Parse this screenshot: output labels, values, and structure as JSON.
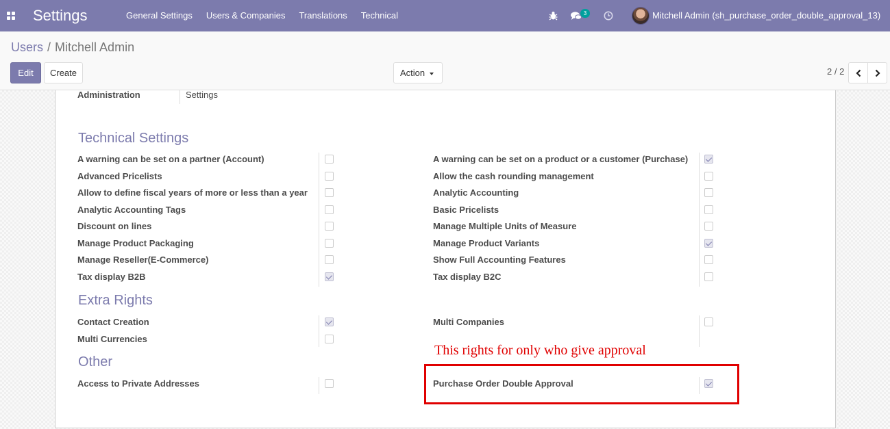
{
  "navbar": {
    "app_title": "Settings",
    "menu": [
      "General Settings",
      "Users & Companies",
      "Translations",
      "Technical"
    ],
    "chat_badge": "3",
    "user": "Mitchell Admin (sh_purchase_order_double_approval_13)"
  },
  "breadcrumb": {
    "parent": "Users",
    "sep": "/",
    "current": "Mitchell Admin"
  },
  "buttons": {
    "edit": "Edit",
    "create": "Create",
    "action": "Action"
  },
  "pager": {
    "value": "2 / 2"
  },
  "admin": {
    "label": "Administration",
    "value": "Settings"
  },
  "sections": {
    "technical": "Technical Settings",
    "extra": "Extra Rights",
    "other": "Other"
  },
  "technical_left": [
    {
      "label": "A warning can be set on a partner (Account)",
      "checked": false
    },
    {
      "label": "Advanced Pricelists",
      "checked": false
    },
    {
      "label": "Allow to define fiscal years of more or less than a year",
      "checked": false
    },
    {
      "label": "Analytic Accounting Tags",
      "checked": false
    },
    {
      "label": "Discount on lines",
      "checked": false
    },
    {
      "label": "Manage Product Packaging",
      "checked": false
    },
    {
      "label": "Manage Reseller(E-Commerce)",
      "checked": false
    },
    {
      "label": "Tax display B2B",
      "checked": true
    }
  ],
  "technical_right": [
    {
      "label": "A warning can be set on a product or a customer (Purchase)",
      "checked": true
    },
    {
      "label": "Allow the cash rounding management",
      "checked": false
    },
    {
      "label": "Analytic Accounting",
      "checked": false
    },
    {
      "label": "Basic Pricelists",
      "checked": false
    },
    {
      "label": "Manage Multiple Units of Measure",
      "checked": false
    },
    {
      "label": "Manage Product Variants",
      "checked": true
    },
    {
      "label": "Show Full Accounting Features",
      "checked": false
    },
    {
      "label": "Tax display B2C",
      "checked": false
    }
  ],
  "extra_left": [
    {
      "label": "Contact Creation",
      "checked": true
    },
    {
      "label": "Multi Currencies",
      "checked": false
    }
  ],
  "extra_right": [
    {
      "label": "Multi Companies",
      "checked": false
    }
  ],
  "other_left": [
    {
      "label": "Access to Private Addresses",
      "checked": false
    }
  ],
  "other_right": [
    {
      "label": "Purchase Order Double Approval",
      "checked": true
    }
  ],
  "annotation": "This rights for only who give approval"
}
